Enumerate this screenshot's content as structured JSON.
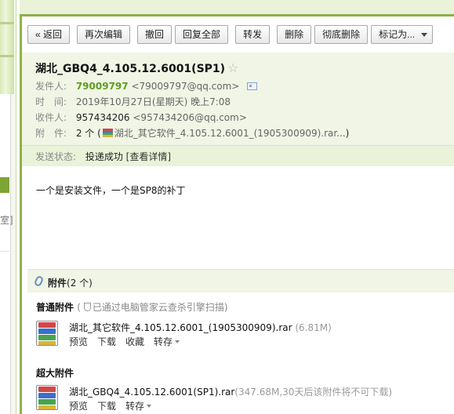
{
  "toolbar": {
    "back": "« 返回",
    "reedit": "再次编辑",
    "recall": "撤回",
    "reply_all": "回复全部",
    "forward": "转发",
    "delete": "删除",
    "perm_delete": "彻底删除",
    "mark_as": "标记为..."
  },
  "mail": {
    "subject": "湖北_GBQ4_4.105.12.6001(SP1)",
    "from_label": "发件人:",
    "from_name": "79009797",
    "from_addr": "<79009797@qq.com>",
    "time_label": "时　间:",
    "time": "2019年10月27日(星期天) 晚上7:08",
    "to_label": "收件人:",
    "to_name": "957434206",
    "to_addr": "<957434206@qq.com>",
    "att_label": "附　件:",
    "att_summary_pre": "2 个 (",
    "att_summary_file": "湖北_其它软件_4.105.12.6001_(1905300909).rar...",
    "att_summary_post": ")",
    "status_label": "发送状态:",
    "status": "投递成功",
    "status_link": "[查看详情]",
    "body": "一个是安装文件，一个是SP8的补丁"
  },
  "attachments": {
    "title": "附件",
    "count": "(2 个)",
    "normal_label": "普通附件",
    "scan_text": "已通过电脑管家云查杀引擎扫描)",
    "scan_open": "(",
    "big_label": "超大附件",
    "files": [
      {
        "name": "湖北_其它软件_4.105.12.6001_(1905300909).rar",
        "size": "(6.81M)",
        "actions": [
          "预览",
          "下载",
          "收藏",
          "转存"
        ]
      },
      {
        "name": "湖北_GBQ4_4.105.12.6001(SP1).rar",
        "size": "(347.68M,30天后该附件将不可下载)",
        "actions": [
          "预览",
          "下载",
          "转存"
        ]
      }
    ]
  },
  "left": {
    "mark": "室]"
  },
  "colors": {
    "accent_green": "#8fb04a",
    "sender_green": "#5f9c1f",
    "header_bg": "#f0f5e5"
  }
}
